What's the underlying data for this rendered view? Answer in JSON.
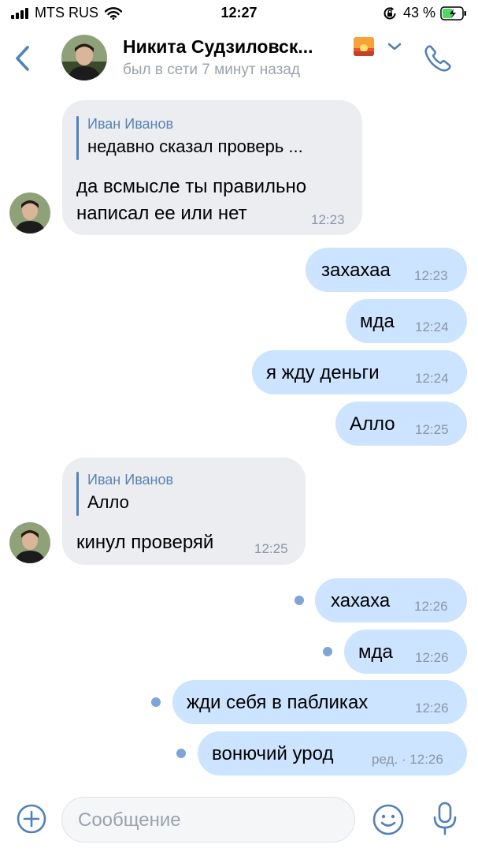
{
  "status_bar": {
    "carrier": "MTS RUS",
    "time": "12:27",
    "battery": "43 %"
  },
  "header": {
    "contact_name": "Никита Судзиловск...",
    "last_seen": "был в сети 7 минут назад"
  },
  "messages": [
    {
      "dir": "in",
      "quote_author": "Иван Иванов",
      "quote_text": "недавно сказал проверь ...",
      "text_lines": [
        "да всмысле ты правильно",
        "написал ее или нет"
      ],
      "time": "12:23"
    },
    {
      "dir": "out",
      "text": "захахаа",
      "time": "12:23"
    },
    {
      "dir": "out",
      "text": "мда",
      "time": "12:24"
    },
    {
      "dir": "out",
      "text": "я жду деньги",
      "time": "12:24"
    },
    {
      "dir": "out",
      "text": "Алло",
      "time": "12:25"
    },
    {
      "dir": "in",
      "quote_author": "Иван Иванов",
      "quote_text": "Алло",
      "text": "кинул проверяй",
      "time": "12:25"
    },
    {
      "dir": "out",
      "text": "хахаха",
      "time": "12:26",
      "unread": true
    },
    {
      "dir": "out",
      "text": "мда",
      "time": "12:26",
      "unread": true
    },
    {
      "dir": "out",
      "text": "жди себя в пабликах",
      "time": "12:26",
      "unread": true
    },
    {
      "dir": "out",
      "text": "вонючий урод",
      "time": "ред. · 12:26",
      "unread": true
    }
  ],
  "composer": {
    "placeholder": "Сообщение"
  },
  "colors": {
    "accent": "#5181b8",
    "incoming_bubble": "#ebedf0",
    "outgoing_bubble": "#cce4ff",
    "unread_dot": "#7fa4d6"
  }
}
